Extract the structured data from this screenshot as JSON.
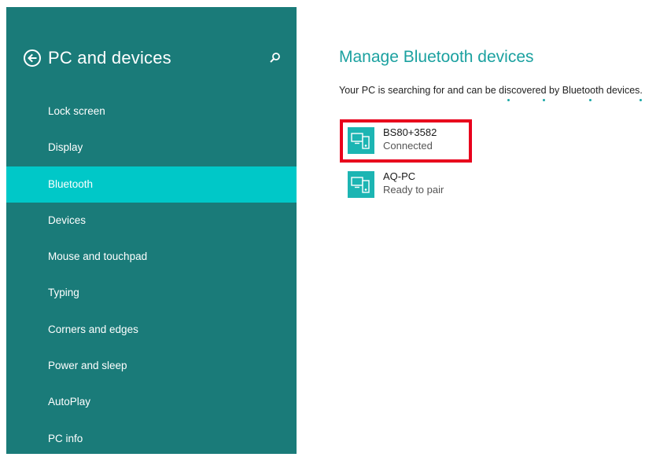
{
  "sidebar": {
    "title": "PC and devices",
    "items": [
      {
        "label": "Lock screen"
      },
      {
        "label": "Display"
      },
      {
        "label": "Bluetooth"
      },
      {
        "label": "Devices"
      },
      {
        "label": "Mouse and touchpad"
      },
      {
        "label": "Typing"
      },
      {
        "label": "Corners and edges"
      },
      {
        "label": "Power and sleep"
      },
      {
        "label": "AutoPlay"
      },
      {
        "label": "PC info"
      }
    ],
    "selected_label": "Bluetooth"
  },
  "main": {
    "title": "Manage Bluetooth devices",
    "status": "Your PC is searching for and can be discovered by Bluetooth devices.",
    "devices": [
      {
        "name": "BS80+3582",
        "status": "Connected",
        "icon": "pc-phone-icon"
      },
      {
        "name": "AQ-PC",
        "status": "Ready to pair",
        "icon": "pc-phone-icon"
      }
    ]
  },
  "colors": {
    "sidebar_bg": "#1a7b79",
    "selected_bg": "#00c8c8",
    "accent": "#1ba1a0",
    "device_icon_bg": "#1cb5b3",
    "highlight": "#e8001c"
  },
  "icons": {
    "back": "back-arrow-icon",
    "search": "search-icon"
  }
}
